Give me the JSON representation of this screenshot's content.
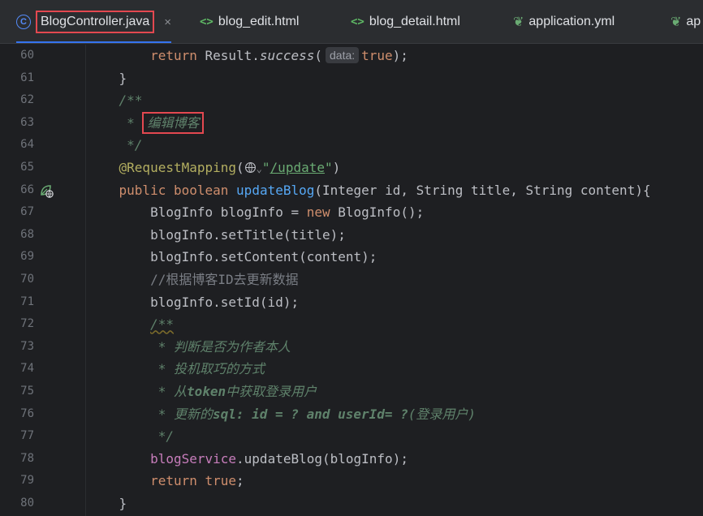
{
  "tabs": [
    {
      "label": "BlogController.java",
      "icon": "class-icon",
      "icon_glyph": "C",
      "active": true
    },
    {
      "label": "blog_edit.html",
      "icon": "html-icon",
      "icon_glyph": "<>"
    },
    {
      "label": "blog_detail.html",
      "icon": "html-icon",
      "icon_glyph": "<>"
    },
    {
      "label": "application.yml",
      "icon": "spring-icon",
      "icon_glyph": "❦"
    },
    {
      "label": "ap",
      "icon": "spring-icon",
      "icon_glyph": "❦"
    }
  ],
  "tab_close_glyph": "×",
  "inlay_hint": "data:",
  "line_numbers": [
    "60",
    "61",
    "62",
    "63",
    "64",
    "65",
    "66",
    "67",
    "68",
    "69",
    "70",
    "71",
    "72",
    "73",
    "74",
    "75",
    "76",
    "77",
    "78",
    "79",
    "80"
  ],
  "code": {
    "l60": {
      "a": "return",
      "b": " Result.",
      "c": "success",
      "d": "(",
      "e": "true",
      "f": ");"
    },
    "l61": "}",
    "l62": "/**",
    "l63": {
      "star": " * ",
      "text": "编辑博客"
    },
    "l64": " */",
    "l65": {
      "ann": "@RequestMapping",
      "open": "(",
      "chev": "⌄",
      "q1": "\"",
      "path": "/update",
      "q2": "\"",
      "close": ")"
    },
    "l66": {
      "kw1": "public",
      "kw2": "boolean",
      "name": "updateBlog",
      "params": "(Integer id, String title, String content){"
    },
    "l67": {
      "a": "BlogInfo blogInfo = ",
      "kw": "new",
      "b": " BlogInfo();"
    },
    "l68": "blogInfo.setTitle(title);",
    "l69": "blogInfo.setContent(content);",
    "l70": "//根据博客ID去更新数据",
    "l71": "blogInfo.setId(id);",
    "l72": "/**",
    "l73": " * 判断是否为作者本人",
    "l74": " * 投机取巧的方式",
    "l75": {
      "a": " * 从",
      "b": "token",
      "c": "中获取登录用户"
    },
    "l76": {
      "a": " * 更新的",
      "b": "sql: id = ? and userId= ?",
      "c": "(登录用户)"
    },
    "l77": " */",
    "l78": {
      "field": "blogService",
      "rest": ".updateBlog(blogInfo);"
    },
    "l79": {
      "kw1": "return",
      "kw2": "true",
      "rest": ";"
    },
    "l80": "}"
  },
  "colors": {
    "background": "#1e1f22",
    "tabbar": "#2b2d30",
    "active_tab_underline": "#3574f0",
    "highlight_box": "#e34850",
    "keyword": "#cf8e6d",
    "function": "#56a8f5",
    "annotation": "#b3ae60",
    "string": "#6aab73",
    "field": "#c77dbb",
    "doc_comment": "#5f826b"
  }
}
